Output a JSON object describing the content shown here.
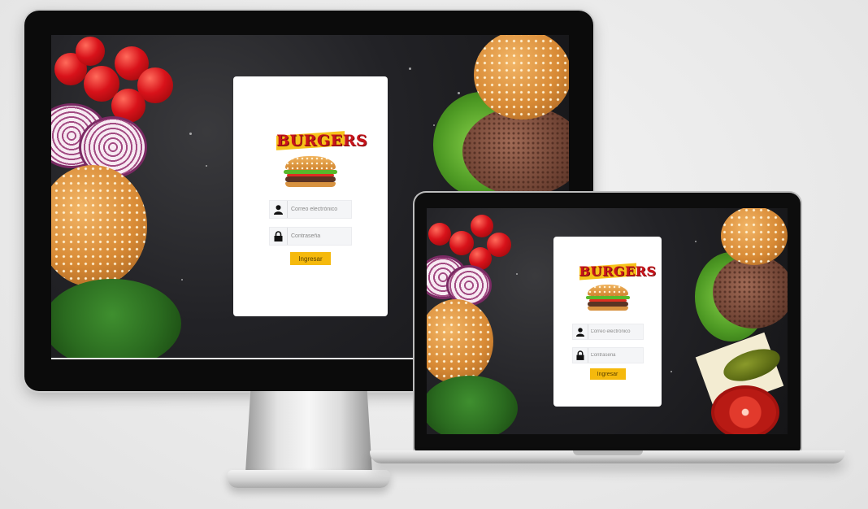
{
  "logo": {
    "text": "BURGERS"
  },
  "login": {
    "email_placeholder": "Correo electrónico",
    "password_placeholder": "Contraseña",
    "submit_label": "Ingresar"
  },
  "colors": {
    "accent": "#f5b90d",
    "logo_red": "#c8141b",
    "background": "#e8e8e8"
  },
  "icons": {
    "user": "user-icon",
    "lock": "lock-icon"
  }
}
